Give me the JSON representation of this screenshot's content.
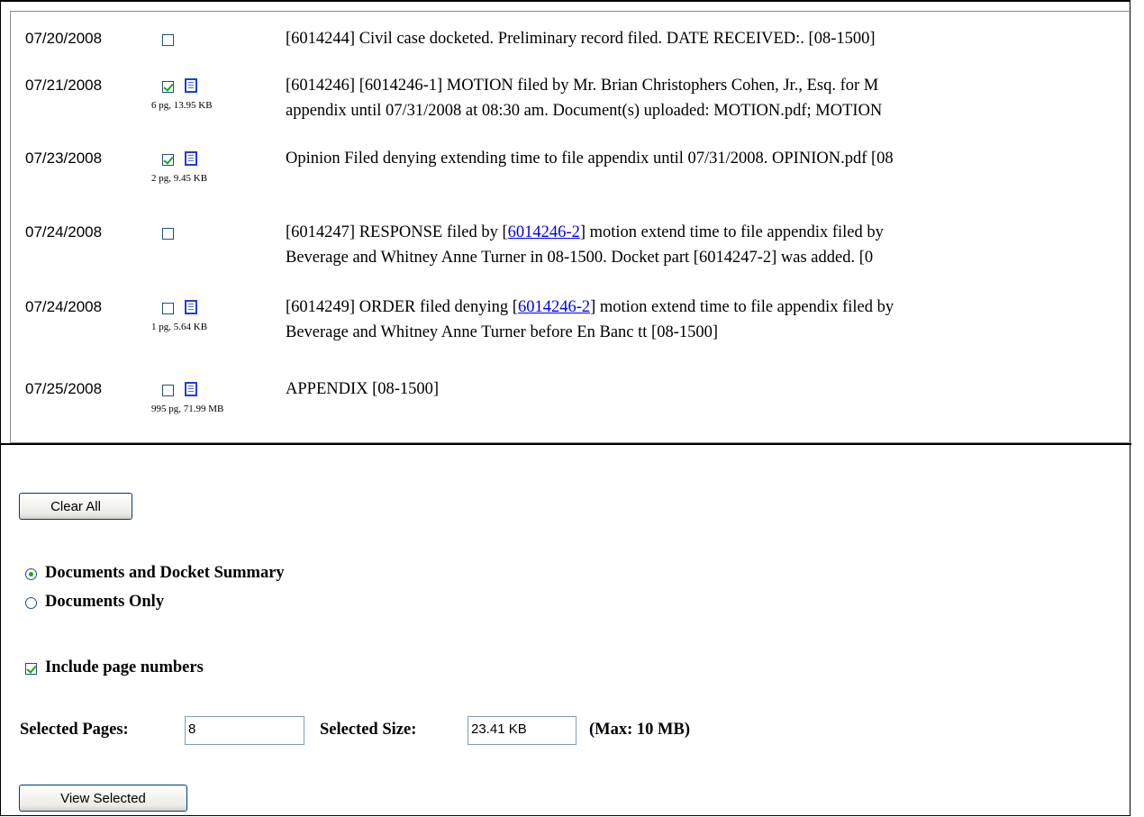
{
  "entries": [
    {
      "date": "07/20/2008",
      "checked": false,
      "has_doc": false,
      "meta": "",
      "lines": [
        "[6014244] Civil case docketed. Preliminary record filed. DATE RECEIVED:. [08-1500]"
      ]
    },
    {
      "date": "07/21/2008",
      "checked": true,
      "has_doc": true,
      "meta": "6 pg, 13.95 KB",
      "lines": [
        "[6014246] [6014246-1] MOTION filed by Mr. Brian Christophers Cohen, Jr., Esq. for M",
        "appendix until 07/31/2008 at 08:30 am. Document(s) uploaded: MOTION.pdf; MOTION"
      ]
    },
    {
      "date": "07/23/2008",
      "checked": true,
      "has_doc": true,
      "meta": "2 pg, 9.45 KB",
      "lines": [
        "Opinion Filed denying extending time to file appendix until 07/31/2008. OPINION.pdf [08"
      ]
    },
    {
      "date": "07/24/2008",
      "checked": false,
      "has_doc": false,
      "meta": "",
      "lines": [
        {
          "pre": "[6014247] RESPONSE filed by [",
          "link": "6014246-2",
          "post": "] motion extend time to file appendix filed by"
        },
        "Beverage and Whitney Anne Turner in 08-1500. Docket part [6014247-2] was added. [0"
      ]
    },
    {
      "date": "07/24/2008",
      "checked": false,
      "has_doc": true,
      "meta": "1 pg, 5.64 KB",
      "lines": [
        {
          "pre": "[6014249] ORDER filed denying [",
          "link": "6014246-2",
          "post": "] motion extend time to file appendix filed by"
        },
        "Beverage and Whitney Anne Turner before En Banc tt [08-1500]"
      ]
    },
    {
      "date": "07/25/2008",
      "checked": false,
      "has_doc": true,
      "meta": "995 pg, 71.99 MB",
      "lines": [
        "APPENDIX [08-1500]"
      ]
    }
  ],
  "clear_all_label": "Clear All",
  "options": [
    {
      "label": "Documents and Docket Summary",
      "selected": true
    },
    {
      "label": "Documents Only",
      "selected": false
    }
  ],
  "include_page_numbers": {
    "label": "Include page numbers",
    "checked": true
  },
  "selected_pages": {
    "label": "Selected Pages:",
    "value": "8"
  },
  "selected_size": {
    "label": "Selected Size:",
    "value": "23.41 KB"
  },
  "max_note": {
    "pre": "(Max: ",
    "value": "10 MB",
    "post": ")"
  },
  "view_selected_label": "View Selected",
  "colors": {
    "link": "#0000ee",
    "check": "#21a121",
    "doc_icon_border": "#1f3fd6"
  }
}
